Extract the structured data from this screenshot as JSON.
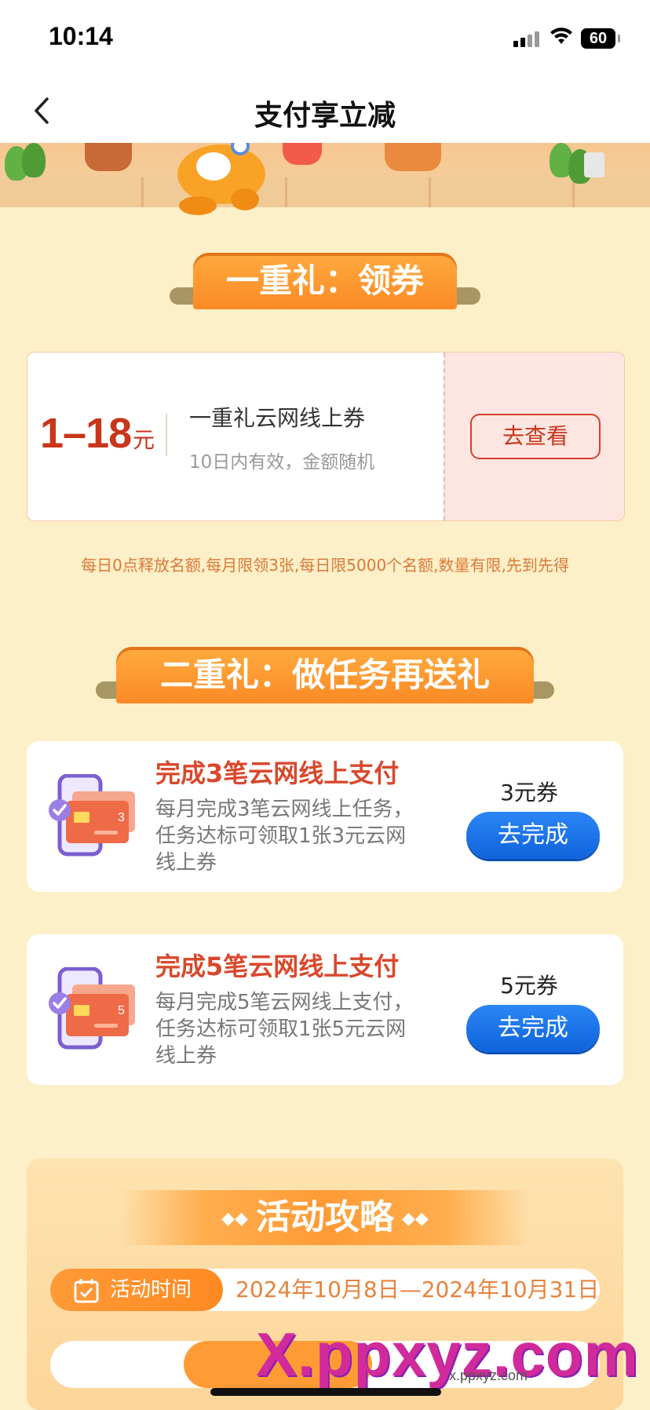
{
  "status_bar": {
    "time": "10:14",
    "battery": "60"
  },
  "nav": {
    "title": "支付享立减"
  },
  "section1": {
    "title": "一重礼：领券"
  },
  "coupon": {
    "amount": "1–18",
    "unit": "元",
    "name": "一重礼云网线上券",
    "desc": "10日内有效，金额随机",
    "button": "去查看"
  },
  "coupon_notice": "每日0点释放名额,每月限领3张,每日限5000个名额,数量有限,先到先得",
  "section2": {
    "title": "二重礼：做任务再送礼"
  },
  "tasks": [
    {
      "title": "完成3笔云网线上支付",
      "desc": "每月完成3笔云网线上任务，任务达标可领取1张3元云网线上券",
      "reward": "3元券",
      "button": "去完成",
      "badge": "3"
    },
    {
      "title": "完成5笔云网线上支付",
      "desc": "每月完成5笔云网线上支付，任务达标可领取1张5元云网线上券",
      "reward": "5元券",
      "button": "去完成",
      "badge": "5"
    }
  ],
  "guide": {
    "title": "活动攻略",
    "time_label": "活动时间",
    "time_value": "2024年10月8日—2024年10月31日"
  },
  "watermark": {
    "main": "X.ppxyz.com",
    "small": "x.ppxyz.com"
  },
  "colors": {
    "accent": "#fb8a25",
    "primary_button": "#1a72e8",
    "coupon_red": "#c8361b",
    "page_bg": "#fdefc7"
  }
}
